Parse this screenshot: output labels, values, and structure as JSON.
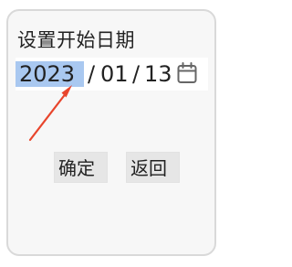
{
  "dialog": {
    "title": "设置开始日期"
  },
  "date_input": {
    "year": "2023",
    "month": "01",
    "day": "13",
    "separator": "/",
    "selected_segment": "year",
    "calendar_icon": "calendar-icon"
  },
  "annotation": {
    "arrow_color": "#e8452c"
  },
  "buttons": {
    "confirm_label": "确定",
    "back_label": "返回"
  },
  "colors": {
    "selection": "#a9c8f0",
    "card_background": "#f7f7f7",
    "card_border": "#d9d9d9"
  }
}
